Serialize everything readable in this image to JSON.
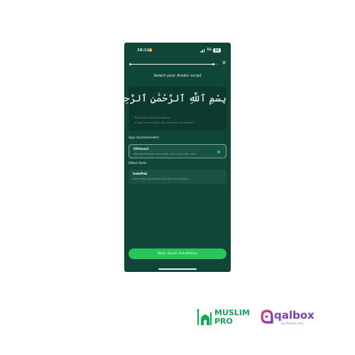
{
  "status_bar": {
    "time": "16:11",
    "network": "5G",
    "battery": "84"
  },
  "onboarding": {
    "progress": 0.95
  },
  "screen": {
    "title": "Select your Arabic script",
    "preview": {
      "arabic_text": "بِسْمِ ٱللَّهِ ٱلرَّحْمَٰنِ ٱلرَّحِيمِ ۝",
      "transliteration": "Bismillahir-rahmanir-raheem",
      "translation": "In the name of Allah, the Gracious, the Merciful"
    },
    "recommended_heading": "App recommended",
    "other_heading": "Other fonts",
    "options": [
      {
        "name": "Uthmani",
        "description": "Standard Madinah-style script, clear and widely used",
        "selected": true
      },
      {
        "name": "IndoPak",
        "description": "South Asian script with extra aids for recitation",
        "selected": false
      }
    ],
    "next_button": "Next: Quran Translations"
  },
  "brands": {
    "muslim_pro": {
      "line1": "MUSLIM",
      "line2": "PRO",
      "color": "#14a85a"
    },
    "qalbox": {
      "name": "qalbox",
      "byline": "by Muslim Pro",
      "color": "#7b3fb8"
    }
  },
  "colors": {
    "background": "#12453a",
    "accent": "#27c55a",
    "card": "#1a5245"
  }
}
